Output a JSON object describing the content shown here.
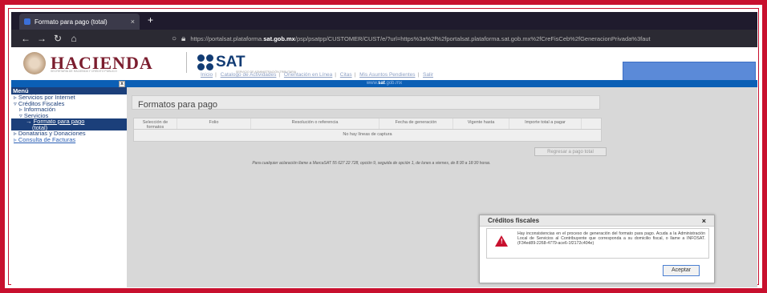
{
  "browser": {
    "tab_title": "Formato para pago (total)",
    "tab_close": "×",
    "new_tab": "+",
    "nav": {
      "back": "←",
      "forward": "→",
      "reload": "↻",
      "home": "⌂"
    },
    "url_prefix": "https://portalsat.plataforma.",
    "url_domain": "sat.gob.mx",
    "url_suffix": "/psp/psatpp/CUSTOMER/CUST/e/?url=https%3a%2f%2fportalsat.plataforma.sat.gob.mx%2fCreFisCeb%2fGeneracionPrivada%3faut"
  },
  "header": {
    "hacienda": "HACIENDA",
    "hacienda_sub": "SECRETARÍA DE HACIENDA Y CRÉDITO PÚBLICO",
    "sat": "SAT",
    "sat_sub": "SERVICIO DE ADMINISTRACIÓN TRIBUTARIA"
  },
  "topmenu": {
    "items": [
      "Inicio",
      "Catalogo de Actividades",
      "Orientación en Línea",
      "Citas",
      "Mis Asuntos Pendientes",
      "Salir"
    ],
    "sep": "|"
  },
  "bluebar": {
    "prefix": "www.",
    "bold": "sat",
    "suffix": ".gob.mx"
  },
  "sidemenu": {
    "title": "Menú",
    "close": "x",
    "items": [
      "Servicios por Internet",
      "Créditos Fiscales",
      "Información",
      "Servicios",
      "Formato para pago",
      "(total)",
      "Donatarias y Donaciones",
      "Consulta de Facturas"
    ]
  },
  "main": {
    "title": "Formatos para pago",
    "columns": [
      "Selección de formatos",
      "Folio",
      "Resolución o referencia",
      "Fecha de generación",
      "Vigente hasta",
      "Importe total a pagar"
    ],
    "empty": "No hay líneas de captura",
    "regresar": "Regresar a pago total",
    "note": "Para cualquier aclaración llame a MarcaSAT 55 627 22 728, opción 9, seguida de opción 1, de lunes a viernes, de 8:30 a 18:30 horas."
  },
  "dialog": {
    "title": "Créditos fiscales",
    "close": "×",
    "message": "Hay inconsistencias en el proceso de generación del formato para pago. Acuda a la Administración Local de Servicios al Contribuyente que corresponda a su domicilio fiscal, o llame a INFOSAT. (F34ed89-2268-4779-ace6-1f2172c404e)",
    "accept": "Aceptar"
  },
  "colors": {
    "frame": "#c8102e",
    "sat_blue": "#123c74",
    "hacienda": "#7b1d2e",
    "bluebar": "#0b5fb5",
    "accent_box": "#5b8ad8"
  }
}
